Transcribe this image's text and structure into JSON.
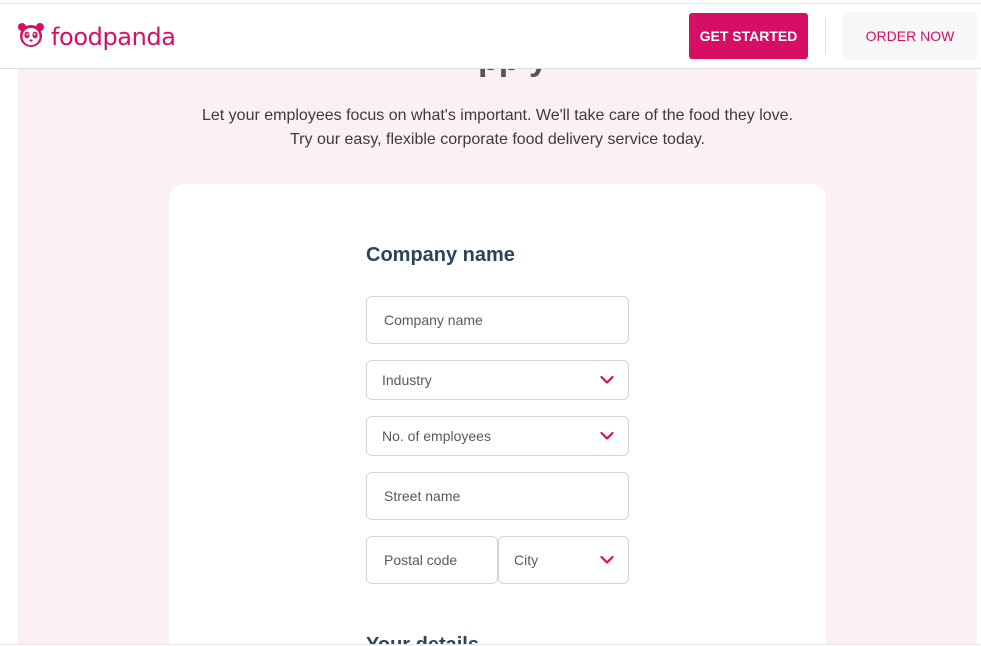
{
  "header": {
    "brand": "foodpanda",
    "get_started": "GET STARTED",
    "order_now": "ORDER NOW"
  },
  "hero": {
    "heading_fragment": "pp y",
    "intro_line1": "Let your employees focus on what's important. We'll take care of the food they love.",
    "intro_line2": "Try our easy, flexible corporate food delivery service today."
  },
  "form": {
    "section_title": "Company name",
    "company_placeholder": "Company name",
    "industry_label": "Industry",
    "employees_label": "No. of employees",
    "street_placeholder": "Street name",
    "postal_placeholder": "Postal code",
    "city_label": "City",
    "next_section_title": "Your details"
  },
  "colors": {
    "brand": "#d70f64",
    "page_bg": "#fdf0f3",
    "title": "#2c4458"
  },
  "icons": {
    "logo": "panda-logo-icon",
    "dropdown": "chevron-down-icon"
  }
}
